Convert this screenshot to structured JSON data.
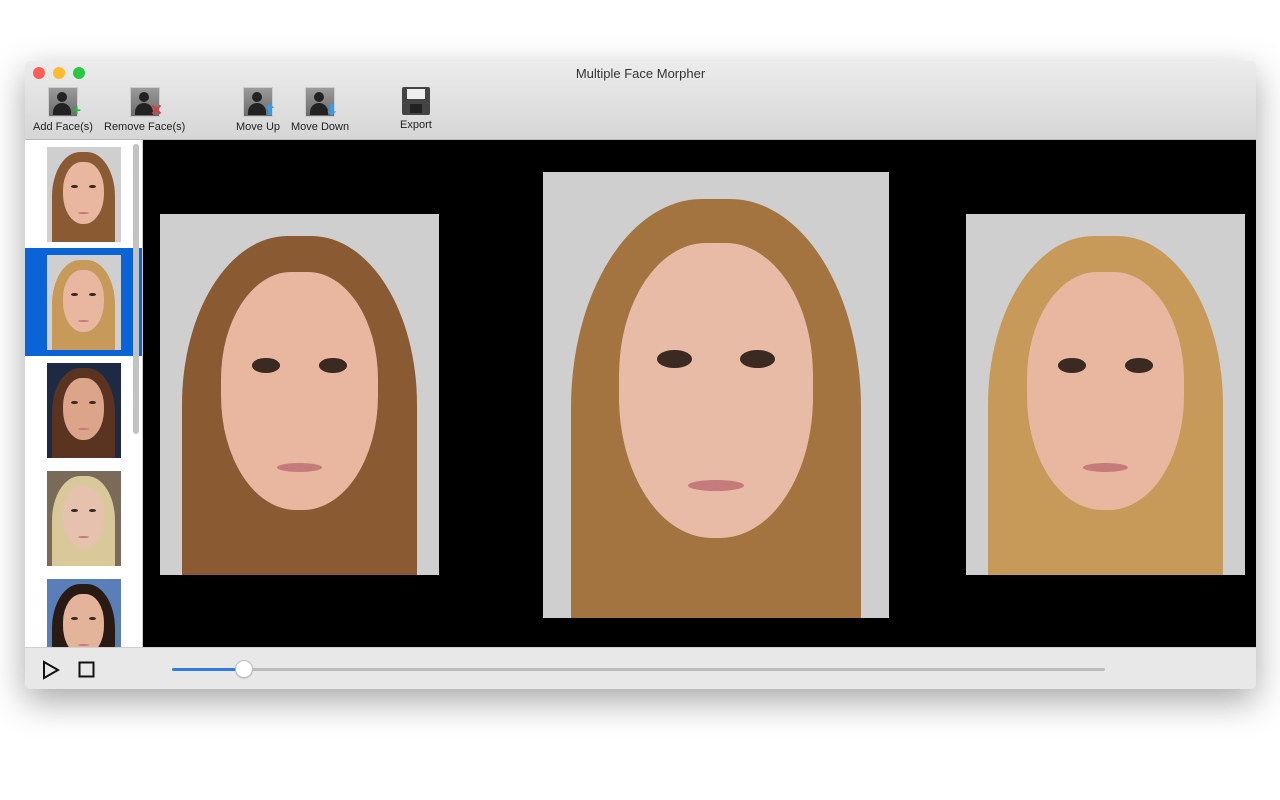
{
  "window": {
    "title": "Multiple Face Morpher"
  },
  "toolbar": {
    "add": "Add Face(s)",
    "remove": "Remove Face(s)",
    "up": "Move Up",
    "down": "Move Down",
    "export": "Export"
  },
  "sidebar": {
    "selected_index": 1,
    "count_visible": 5
  },
  "playback": {
    "progress_percent": 7.7
  },
  "colors": {
    "accent": "#0a64d8",
    "slider": "#2f7de1"
  }
}
